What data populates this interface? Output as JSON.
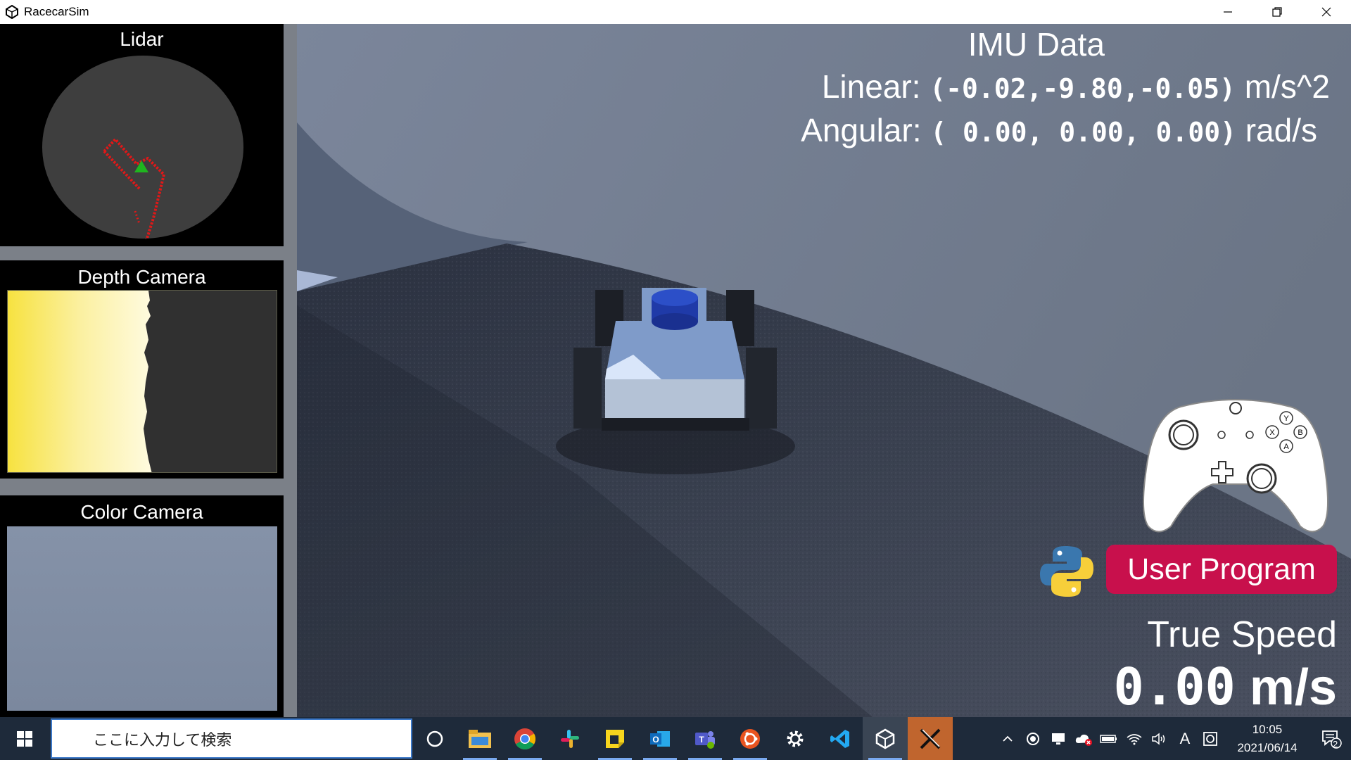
{
  "window": {
    "title": "RacecarSim",
    "icon": "unity-icon",
    "controls": [
      "minimize-icon",
      "restore-icon",
      "close-icon"
    ]
  },
  "panels": {
    "lidar_title": "Lidar",
    "depth_title": "Depth Camera",
    "color_title": "Color Camera"
  },
  "imu": {
    "title": "IMU Data",
    "linear_label": "Linear:",
    "linear_value": "(-0.02,-9.80,-0.05)",
    "linear_unit": "m/s^2",
    "angular_label": "Angular:",
    "angular_value": "( 0.00, 0.00, 0.00)",
    "angular_unit": "rad/s"
  },
  "controller_icon": "xbox-controller-icon",
  "user_program": {
    "label": "User Program",
    "color": "#c8104c"
  },
  "speed": {
    "label": "True Speed",
    "value": "0.00",
    "unit": "m/s"
  },
  "taskbar": {
    "search_placeholder": "ここに入力して検索",
    "apps": [
      "cortana-icon",
      "file-explorer-icon",
      "chrome-icon",
      "slack-icon",
      "sticky-notes-icon",
      "outlook-icon",
      "teams-icon",
      "ubuntu-icon",
      "settings-icon",
      "vscode-icon",
      "unity-icon",
      "xserver-icon"
    ],
    "ime": "A",
    "notification_count": "2",
    "time": "10:05",
    "date": "2021/06/14"
  }
}
